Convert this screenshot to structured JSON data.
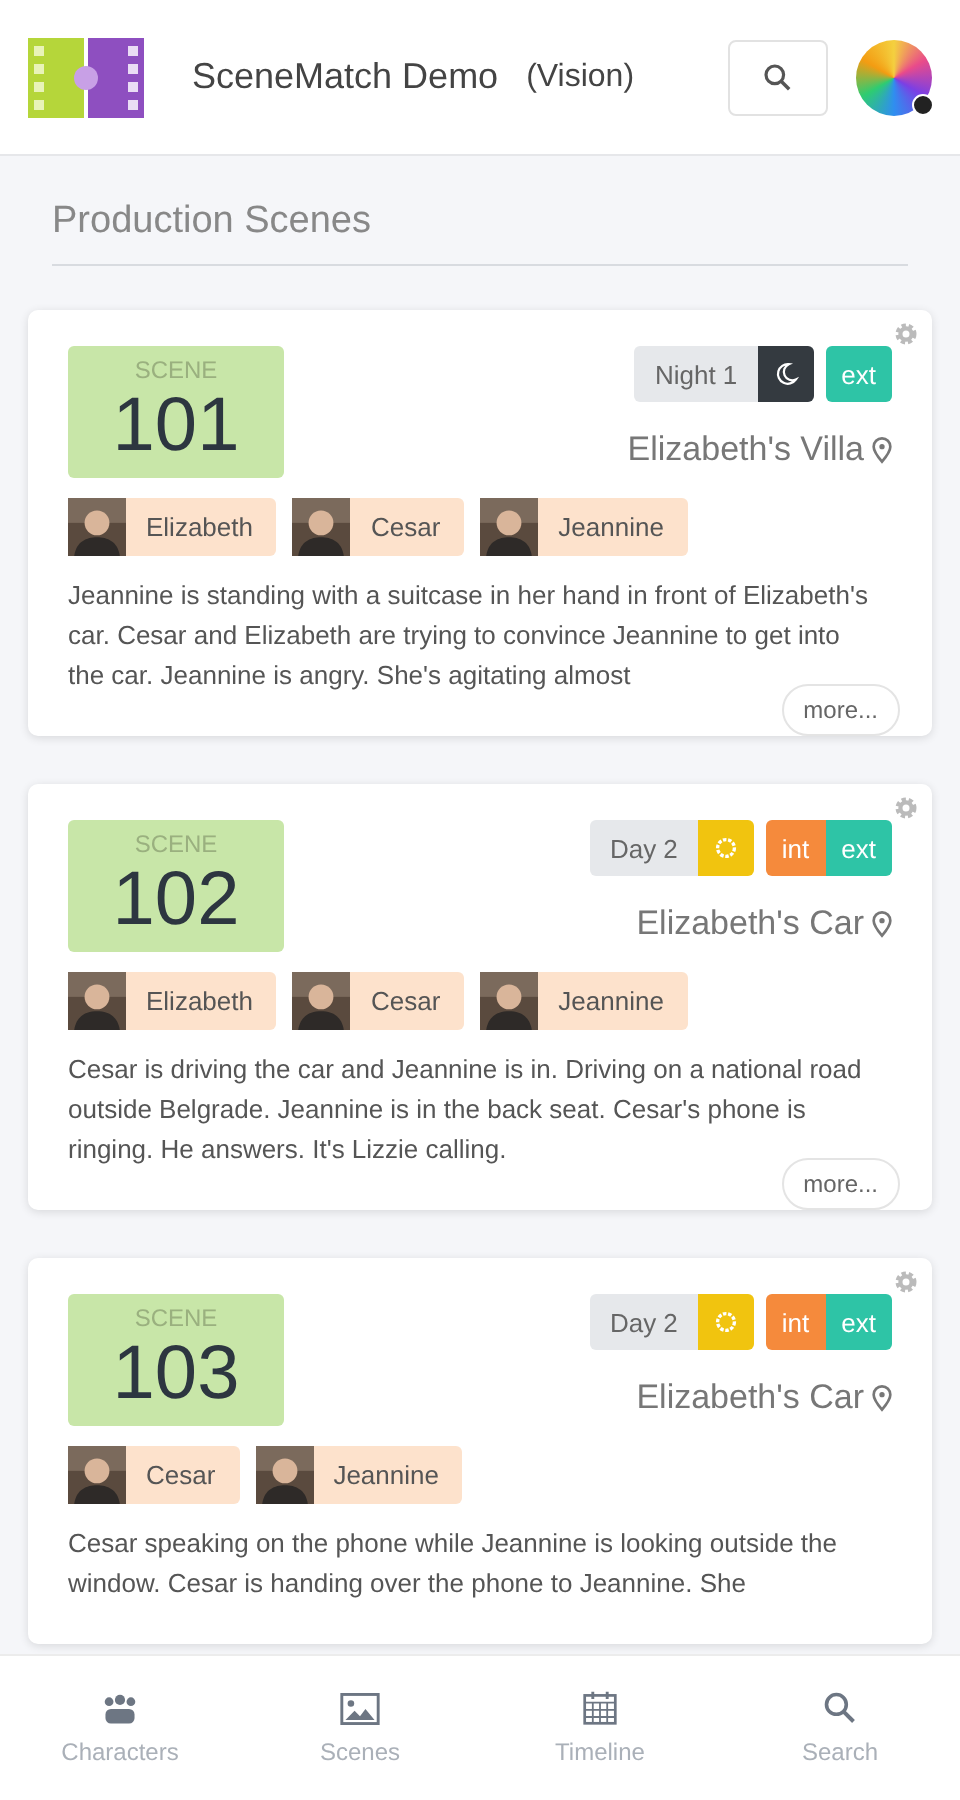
{
  "app_bar": {
    "title": "SceneMatch Demo",
    "subtitle": "(Vision)"
  },
  "section_title": "Production Scenes",
  "scenes": [
    {
      "scene_label": "SCENE",
      "number": "101",
      "time": {
        "label": "Night 1",
        "kind": "night"
      },
      "settings": [
        {
          "label": "ext",
          "kind": "ext"
        }
      ],
      "location": "Elizabeth's Villa",
      "characters": [
        {
          "name": "Elizabeth"
        },
        {
          "name": "Cesar"
        },
        {
          "name": "Jeannine"
        }
      ],
      "description": "Jeannine is standing with a suitcase in her hand in front of Elizabeth's car. Cesar and Elizabeth are trying to convince Jeannine to get into the car. Jeannine is angry. She's agitating almost",
      "more": "more..."
    },
    {
      "scene_label": "SCENE",
      "number": "102",
      "time": {
        "label": "Day 2",
        "kind": "day"
      },
      "settings": [
        {
          "label": "int",
          "kind": "int"
        },
        {
          "label": "ext",
          "kind": "ext"
        }
      ],
      "location": "Elizabeth's Car",
      "characters": [
        {
          "name": "Elizabeth"
        },
        {
          "name": "Cesar"
        },
        {
          "name": "Jeannine"
        }
      ],
      "description": "Cesar is driving the car and Jeannine is in. Driving on a national road outside Belgrade. Jeannine is in the back seat. Cesar's phone is ringing. He answers. It's Lizzie calling.",
      "more": "more..."
    },
    {
      "scene_label": "SCENE",
      "number": "103",
      "time": {
        "label": "Day 2",
        "kind": "day"
      },
      "settings": [
        {
          "label": "int",
          "kind": "int"
        },
        {
          "label": "ext",
          "kind": "ext"
        }
      ],
      "location": "Elizabeth's Car",
      "characters": [
        {
          "name": "Cesar"
        },
        {
          "name": "Jeannine"
        }
      ],
      "description": "Cesar speaking on the phone while Jeannine is looking outside the window. Cesar is handing over the phone to Jeannine. She"
    }
  ],
  "nav": [
    {
      "label": "Characters",
      "kind": "characters"
    },
    {
      "label": "Scenes",
      "kind": "scenes"
    },
    {
      "label": "Timeline",
      "kind": "timeline"
    },
    {
      "label": "Search",
      "kind": "search"
    }
  ]
}
